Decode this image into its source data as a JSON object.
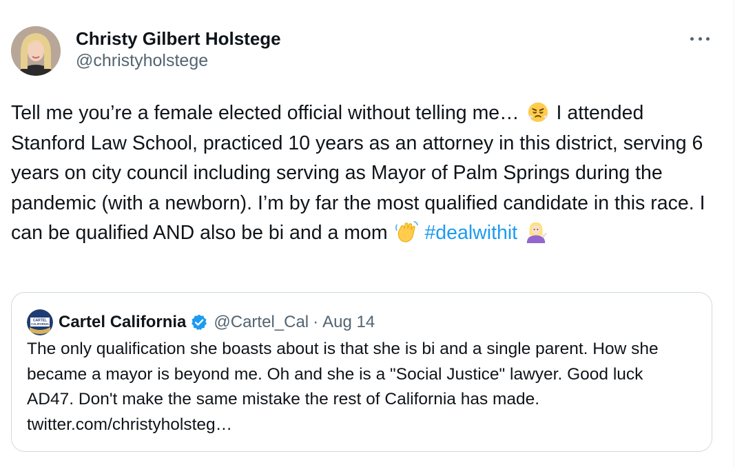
{
  "author": {
    "display_name": "Christy Gilbert Holstege",
    "handle": "@christyholstege"
  },
  "tweet": {
    "text_parts": [
      "Tell me you’re a female elected official without telling me…",
      "I attended Stanford Law School, practiced 10 years as an attorney in this district, serving 6 years on city council including serving as Mayor of Palm Springs during the pandemic (with a newborn). I’m by far the most qualified candidate in this race. I can be qualified AND also be bi and a mom",
      "#dealwithit"
    ],
    "emoji_icons": [
      "steam-from-nose-face-icon",
      "waving-hand-icon",
      "person-tipping-hand-icon"
    ]
  },
  "quoted_tweet": {
    "display_name": "Cartel California",
    "avatar_text": [
      "CARTEL",
      "CALIFORNIA"
    ],
    "handle": "@Cartel_Cal",
    "separator": "·",
    "date": "Aug 14",
    "text": "The only qualification she boasts about is that she is bi and a single parent. How she became a mayor is beyond me. Oh and she is a \"Social Justice\" lawyer. Good luck AD47.  Don't make the same mistake the rest of California has made. twitter.com/christyholsteg…",
    "verified_icon": "verified-badge-icon"
  },
  "colors": {
    "text": "#0f1419",
    "secondary": "#536471",
    "link": "#1d9bf0",
    "border": "#cfd9de",
    "verified": "#1d9bf0"
  },
  "icons": {
    "more": "more-horizontal-icon"
  }
}
